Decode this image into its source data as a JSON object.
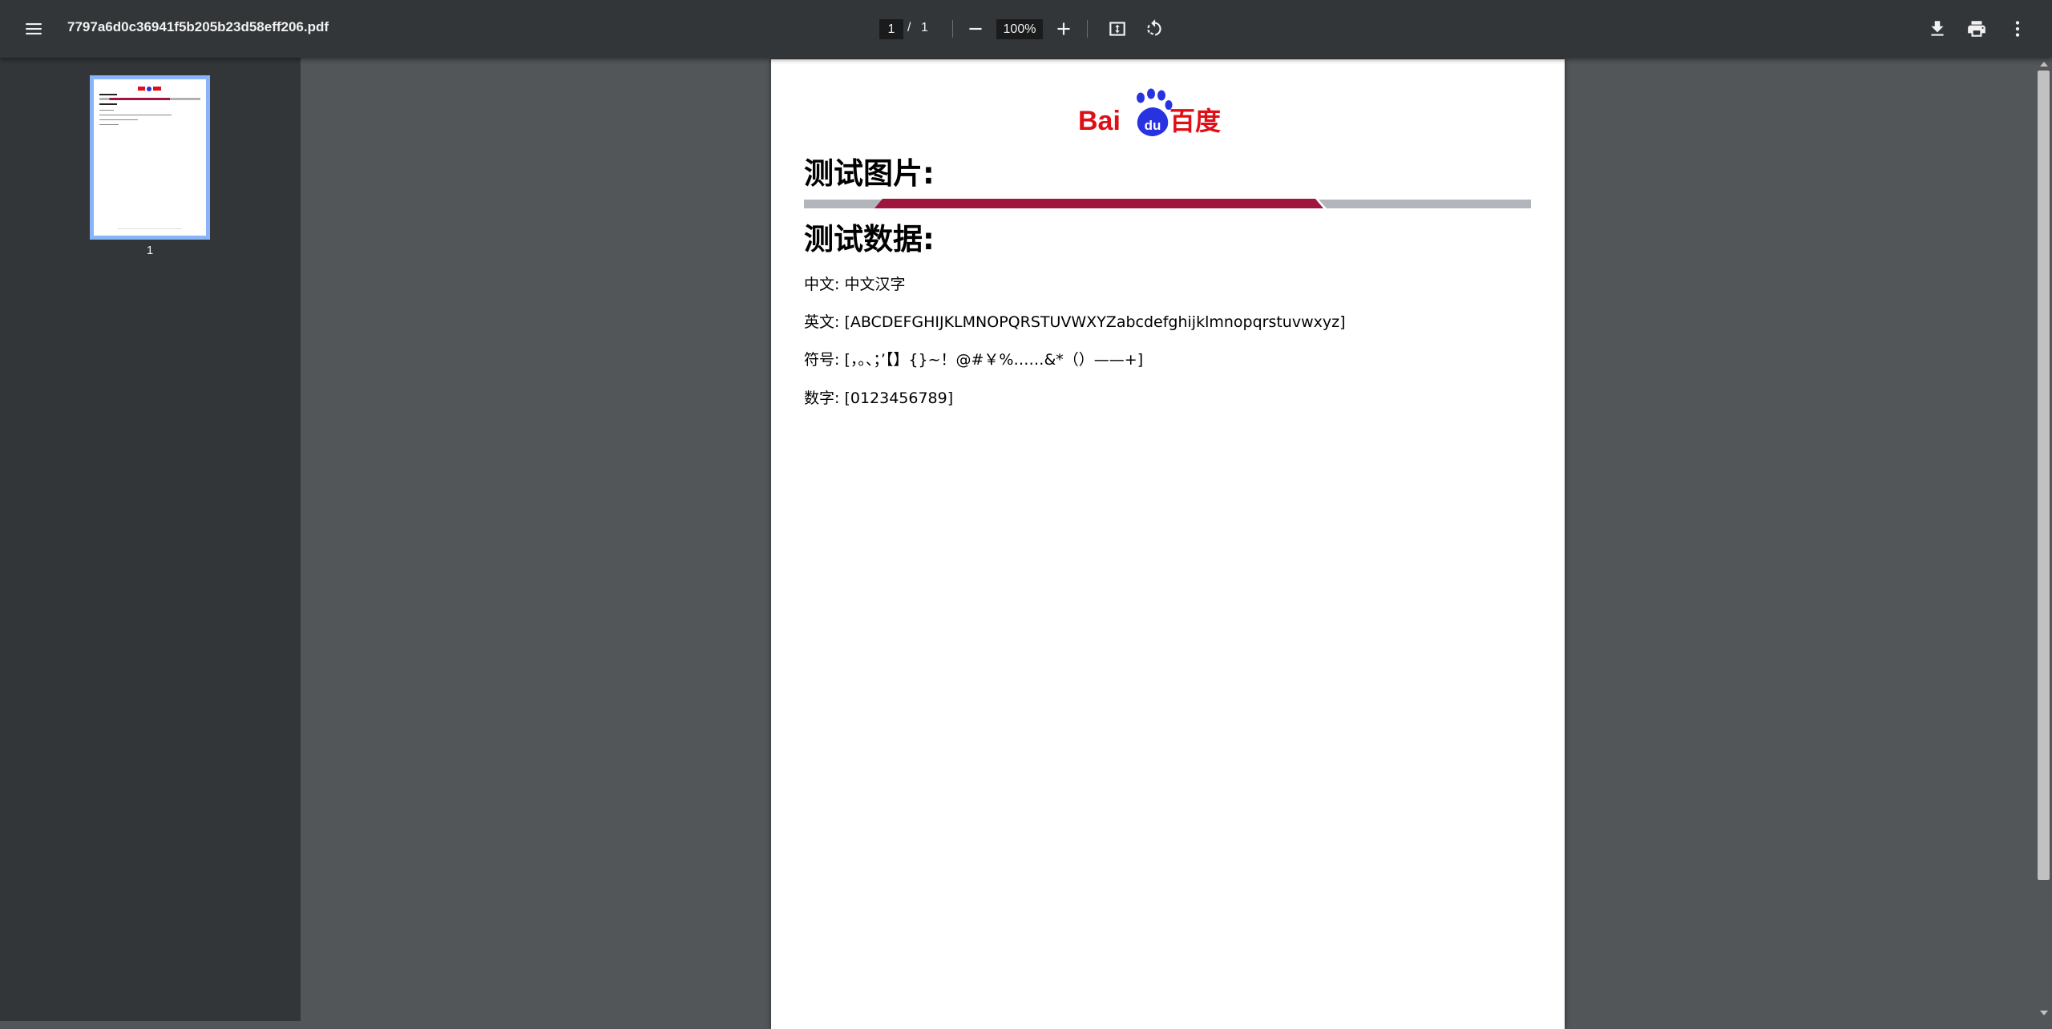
{
  "toolbar": {
    "title": "7797a6d0c36941f5b205b23d58eff206.pdf",
    "current_page": "1",
    "page_separator": "/",
    "total_pages": "1",
    "zoom": "100%"
  },
  "sidebar": {
    "thumbnails": [
      {
        "label": "1"
      }
    ]
  },
  "document": {
    "logo_text_bai": "Bai",
    "logo_text_du": "du",
    "logo_text_cn": "百度",
    "heading_picture": "测试图片:",
    "heading_data": "测试数据:",
    "line_chinese": "中文: 中文汉字",
    "line_english": "英文: [ABCDEFGHIJKLMNOPQRSTUVWXYZabcdefghijklmnopqrstuvwxyz]",
    "line_symbols": "符号: [，。、；’【】{}~！@#￥%……&*（）——+]",
    "line_digits": "数字: [0123456789]"
  },
  "colors": {
    "toolbar_bg": "#323639",
    "viewer_bg": "#525659",
    "thumb_border": "#8ab4f8",
    "divider_red": "#a0153e",
    "divider_gray": "#b2b5bb",
    "baidu_red": "#de0f17",
    "baidu_blue": "#2932e1"
  }
}
